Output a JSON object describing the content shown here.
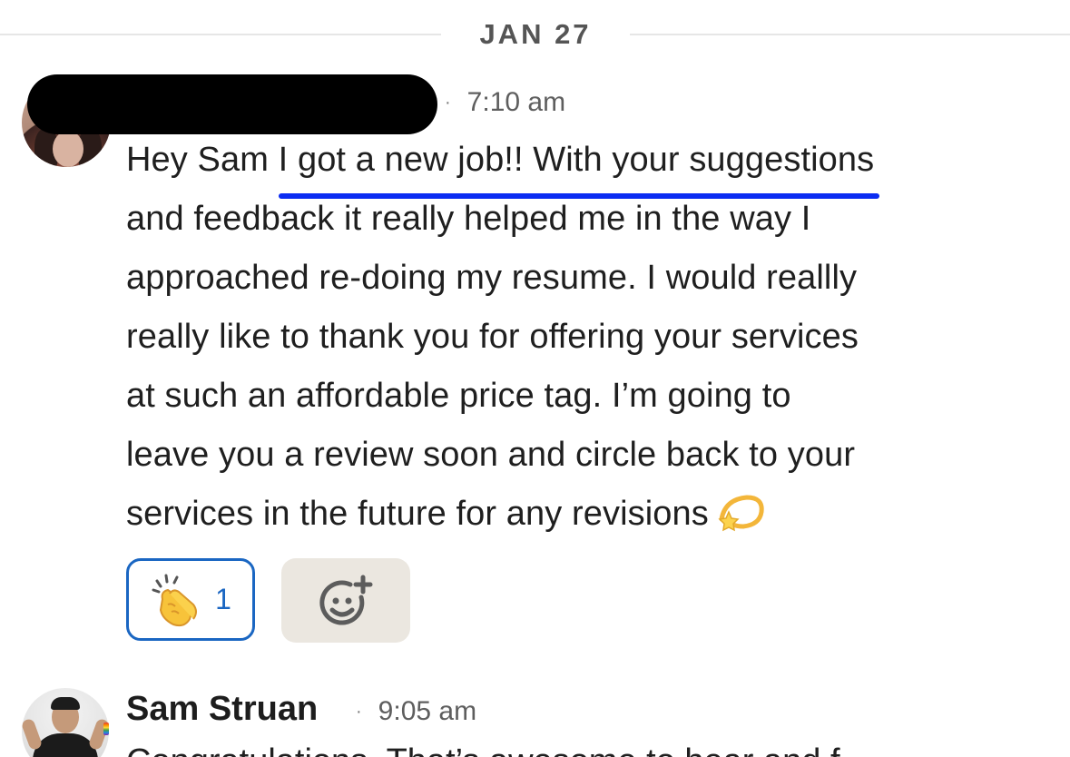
{
  "date_divider": {
    "label": "JAN 27"
  },
  "message_1": {
    "sender_redacted": true,
    "separator": "·",
    "timestamp": "7:10 am",
    "text_lines": {
      "l1_pre": "Hey Sam ",
      "l1_highlight": "I got a new job!! With your suggestions",
      "l2": "and feedback it really helped me in the way I",
      "l3": "approached re-doing my resume. I would reallly",
      "l4": "really like to thank you for offering your services",
      "l5": "at such an affordable price tag. I’m going to",
      "l6": "leave you a review soon and circle back to your",
      "l7": "services in the future for any revisions"
    },
    "emoji": "dizzy-star-icon",
    "reactions": [
      {
        "icon": "clapping-hands-icon",
        "count": "1"
      }
    ],
    "add_reaction_icon": "add-reaction-smiley-icon"
  },
  "message_2": {
    "sender": "Sam Struan",
    "separator": "·",
    "timestamp": "9:05 am",
    "text_partial": "Congratulations. That’s awesome to hear and f"
  },
  "colors": {
    "highlight_underline": "#0b2cf2",
    "reaction_accent": "#1a66c2",
    "add_reaction_bg": "#ebe7e0",
    "divider": "#e6e6e6"
  }
}
